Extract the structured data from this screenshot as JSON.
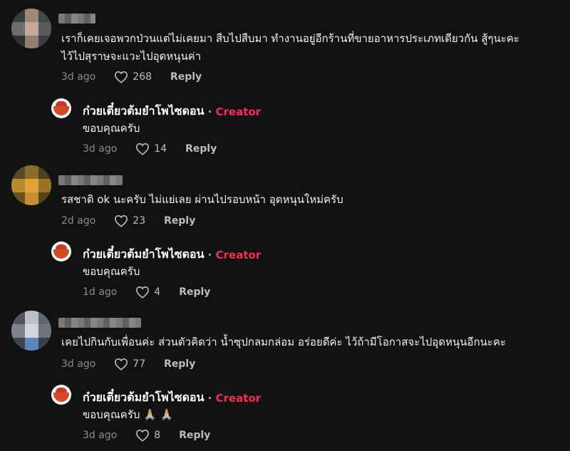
{
  "comments": [
    {
      "text": "เราก็เคยเจอพวกป่วนแต่ไม่เคยมา สืบไปสืบมา ทำงานอยู่อีกร้านที่ขายอาหารประเภทเดียวกัน สู้ๆนะคะ\nไว้ไปสุราษจะแวะไปอุดหนุนค่า",
      "time": "3d ago",
      "likes": "268",
      "reply_label": "Reply",
      "reply": {
        "name": "ก๋วยเตี๋ยวต้มยำโพไซดอน",
        "separator": "·",
        "badge": "Creator",
        "text": "ขอบคุณครับ",
        "time": "3d ago",
        "likes": "14",
        "reply_label": "Reply"
      }
    },
    {
      "text": "รสชาติ ok นะครับ ไม่แย่เลย ผ่านไปรอบหน้า อุดหนุนใหม่ครับ",
      "time": "2d ago",
      "likes": "23",
      "reply_label": "Reply",
      "reply": {
        "name": "ก๋วยเตี๋ยวต้มยำโพไซดอน",
        "separator": "·",
        "badge": "Creator",
        "text": "ขอบคุณครับ",
        "time": "1d ago",
        "likes": "4",
        "reply_label": "Reply"
      }
    },
    {
      "text": "เคยไปกินกับเพื่อนค่ะ ส่วนตัวคิดว่า น้ำซุปกลมกล่อม อร่อยดีค่ะ ไว้ถ้ามีโอกาสจะไปอุดหนุนอีกนะคะ",
      "time": "3d ago",
      "likes": "77",
      "reply_label": "Reply",
      "reply": {
        "name": "ก๋วยเตี๋ยวต้มยำโพไซดอน",
        "separator": "·",
        "badge": "Creator",
        "text": "ขอบคุณครับ 🙏🏼 🙏🏼",
        "time": "3d ago",
        "likes": "8",
        "reply_label": "Reply"
      }
    }
  ],
  "colors": {
    "background": "#121212",
    "creator_badge": "#fe2c55",
    "meta": "#8a8b91"
  },
  "icons": {
    "like": "heart-outline-icon"
  }
}
